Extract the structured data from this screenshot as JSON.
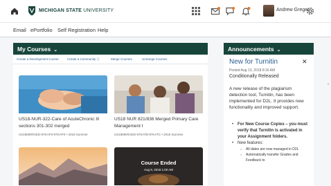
{
  "header": {
    "university_bold": "MICHIGAN STATE",
    "university_rest": " UNIVERSITY",
    "user_name": "Andrew Greger",
    "icons": [
      "home-icon",
      "msu-shield-icon",
      "grid-icon",
      "mail-icon",
      "chat-icon",
      "bell-icon",
      "gear-icon"
    ]
  },
  "nav": [
    "Email",
    "ePortfolio",
    "Self Registration",
    "Help"
  ],
  "my_courses": {
    "title": "My Courses",
    "actions": [
      "Create a Development Course",
      "Create a Community ⓘ",
      "Merge Courses",
      "Unmerge Courses"
    ],
    "cards": [
      {
        "title": "US18-NUR-322-Care of AcuteChronic Ill sections 301-302 merged",
        "meta": "US18MERGED-97KAP3-97KAPS • 2018 Summer"
      },
      {
        "title": "US18 NUR 821/836 Merged Primary Care Management I",
        "meta": "US18MERGED-97KATB-97KATC • 2018 Summer"
      },
      {
        "title": ""
      },
      {
        "title": "",
        "status": "Course Ended",
        "status_date": "Aug 9, 2018 1:00 AM"
      }
    ]
  },
  "announcements": {
    "title": "Announcements",
    "item_title": "New for Turnitin",
    "posted": "Posted Aug 13, 2018 8:16 AM",
    "subtitle": "Conditionally Released",
    "body": "A new release of the plagiarism detection tool, Turnitin, has been implemented for D2L. It provides new functionality and improved support.",
    "bullet1": "For New Course Copies – you must verify that Turnitin is activated in your Assignment folders.",
    "bullet2": "New features:",
    "sub1": "All dates are now managed in D2L",
    "sub2": "Automatically transfer Grades and Feedback to"
  },
  "colors": {
    "brand": "#18453b",
    "link": "#2a5d8f"
  }
}
